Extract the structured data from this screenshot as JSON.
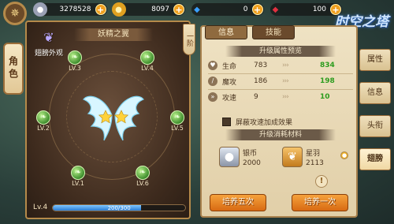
{
  "resources": [
    {
      "icon": "coin-stack-icon",
      "value": "3278528",
      "color": "#c8c8d8"
    },
    {
      "icon": "gold-coin-icon",
      "value": "8097",
      "color": "#f0b020"
    },
    {
      "icon": "blue-diamond-icon",
      "value": "0",
      "color": "#3aa0ff"
    },
    {
      "icon": "red-gem-icon",
      "value": "100",
      "color": "#e03040"
    }
  ],
  "logo_text": "时空之塔",
  "left_tab": "角色",
  "wing": {
    "title": "妖精之翼",
    "appearance_label": "翅膀外观",
    "nodes": [
      {
        "label": "LV.3"
      },
      {
        "label": "LV.4"
      },
      {
        "label": "LV.2"
      },
      {
        "label": "LV.5"
      },
      {
        "label": "LV.1"
      },
      {
        "label": "LV.6"
      }
    ],
    "level_label": "Lv.4",
    "exp_text": "200/300",
    "exp_fraction": 0.667
  },
  "hanging_tag": "一阶",
  "info": {
    "tabs": [
      {
        "label": "信息"
      },
      {
        "label": "技能"
      }
    ],
    "preview_header": "升级属性预览",
    "stats": [
      {
        "name": "生命",
        "old": "783",
        "new": "834"
      },
      {
        "name": "魔攻",
        "old": "186",
        "new": "198"
      },
      {
        "name": "攻速",
        "old": "9",
        "new": "10"
      }
    ],
    "checkbox_label": "屏蔽攻速加成效果",
    "materials_header": "升级消耗材料",
    "materials": [
      {
        "name": "银币",
        "qty": "2000"
      },
      {
        "name": "星羽",
        "qty": "2113"
      }
    ],
    "buttons": {
      "five": "培养五次",
      "once": "培养一次"
    }
  },
  "side_tabs": [
    {
      "label": "属性"
    },
    {
      "label": "信息"
    },
    {
      "label": "头衔"
    },
    {
      "label": "翅膀"
    }
  ]
}
